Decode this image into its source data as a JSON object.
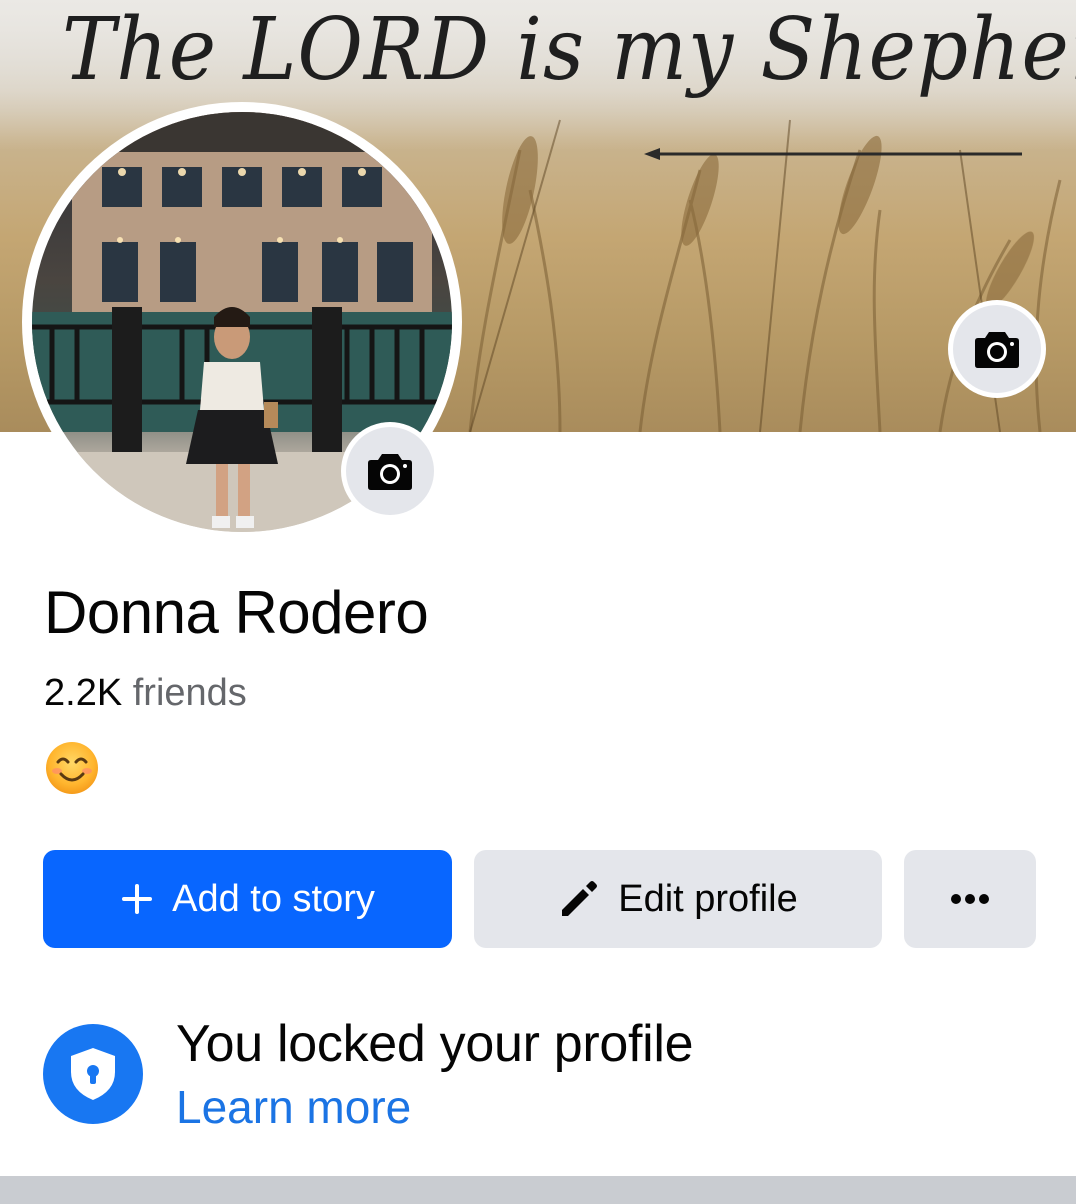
{
  "cover": {
    "text": "The LORD is my Shepherd.",
    "camera_icon": "camera-icon"
  },
  "avatar": {
    "camera_icon": "camera-icon"
  },
  "profile": {
    "name": "Donna Rodero",
    "friends_count": "2.2K",
    "friends_label": "friends",
    "bio_emoji": "smiling-face-with-smiling-eyes"
  },
  "actions": {
    "add_story_label": "Add to story",
    "add_story_icon": "plus-icon",
    "edit_profile_label": "Edit profile",
    "edit_profile_icon": "pencil-icon",
    "more_icon": "more-dots-icon"
  },
  "lock_notice": {
    "title": "You locked your profile",
    "link": "Learn more",
    "icon": "shield-lock-icon"
  },
  "colors": {
    "primary": "#0866ff",
    "secondary_button": "#e4e6eb",
    "link": "#1b74e4",
    "muted_text": "#65676b",
    "divider": "#c9ccd1"
  }
}
